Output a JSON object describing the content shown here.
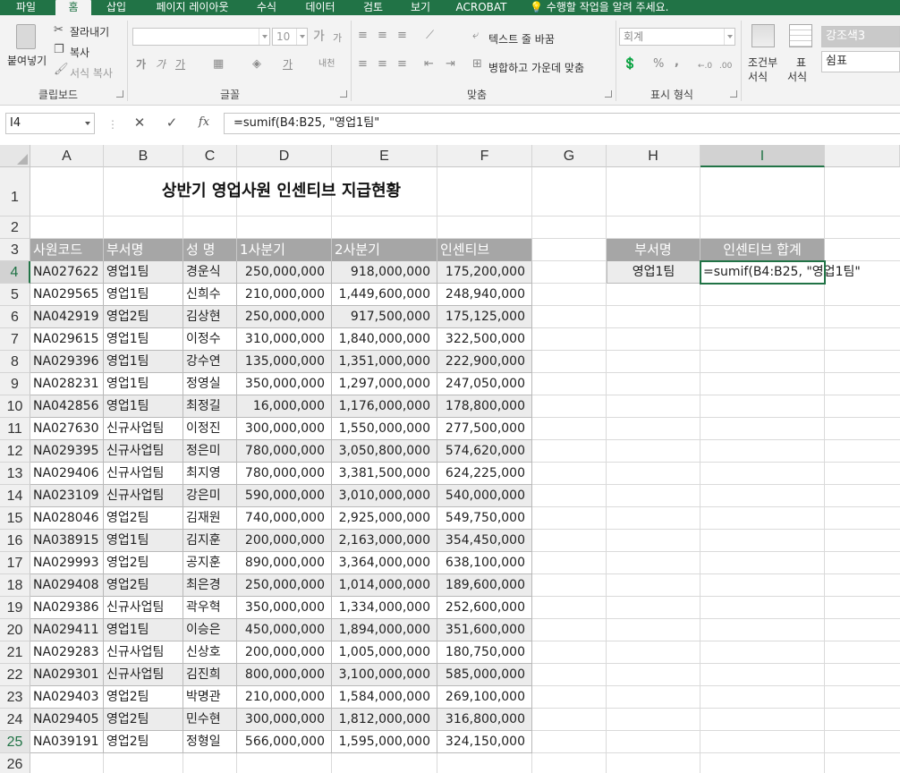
{
  "ribbon": {
    "tabs": [
      "파일",
      "홈",
      "삽입",
      "페이지 레이아웃",
      "수식",
      "데이터",
      "검토",
      "보기",
      "ACROBAT"
    ],
    "tell_me": "수행할 작업을 알려 주세요.",
    "clipboard": {
      "paste": "붙여넣기",
      "cut": "잘라내기",
      "copy": "복사",
      "format_painter": "서식 복사",
      "label": "클립보드"
    },
    "font": {
      "size": "10",
      "grow": "가",
      "shrink": "가",
      "bold": "가",
      "italic": "가",
      "underline": "가",
      "font_color": "가",
      "phonetic": "내천",
      "label": "글꼴"
    },
    "alignment": {
      "wrap": "텍스트 줄 바꿈",
      "merge": "병합하고 가운데 맞춤",
      "label": "맞춤"
    },
    "number": {
      "format": "회계",
      "percent": "%",
      "comma": ",",
      "inc": "←.0",
      "dec": ".00",
      "label": "표시 형식"
    },
    "styles": {
      "cond_1": "조건부",
      "cond_2": "서식",
      "table_1": "표",
      "table_2": "서식",
      "accent3": "강조색3",
      "comma_style": "쉼표"
    }
  },
  "formula_bar": {
    "name_box": "I4",
    "cancel": "✕",
    "enter": "✓",
    "fx": "fx",
    "formula": "=sumif(B4:B25, \"영업1팀\""
  },
  "sheet": {
    "columns": [
      "A",
      "B",
      "C",
      "D",
      "E",
      "F",
      "G",
      "H",
      "I"
    ],
    "row_numbers": [
      "1",
      "2",
      "3",
      "4",
      "5",
      "6",
      "7",
      "8",
      "9",
      "10",
      "11",
      "12",
      "13",
      "14",
      "15",
      "16",
      "17",
      "18",
      "19",
      "20",
      "21",
      "22",
      "23",
      "24",
      "25",
      "26"
    ],
    "title": "상반기 영업사원 인센티브 지급현황",
    "headers": [
      "사원코드",
      "부서명",
      "성  명",
      "1사분기",
      "2사분기",
      "인센티브"
    ],
    "rows": [
      [
        "NA027622",
        "영업1팀",
        "경운식",
        "250,000,000",
        "918,000,000",
        "175,200,000"
      ],
      [
        "NA029565",
        "영업1팀",
        "신희수",
        "210,000,000",
        "1,449,600,000",
        "248,940,000"
      ],
      [
        "NA042919",
        "영업2팀",
        "김상현",
        "250,000,000",
        "917,500,000",
        "175,125,000"
      ],
      [
        "NA029615",
        "영업1팀",
        "이정수",
        "310,000,000",
        "1,840,000,000",
        "322,500,000"
      ],
      [
        "NA029396",
        "영업1팀",
        "강수연",
        "135,000,000",
        "1,351,000,000",
        "222,900,000"
      ],
      [
        "NA028231",
        "영업1팀",
        "정영실",
        "350,000,000",
        "1,297,000,000",
        "247,050,000"
      ],
      [
        "NA042856",
        "영업1팀",
        "최정길",
        "16,000,000",
        "1,176,000,000",
        "178,800,000"
      ],
      [
        "NA027630",
        "신규사업팀",
        "이정진",
        "300,000,000",
        "1,550,000,000",
        "277,500,000"
      ],
      [
        "NA029395",
        "신규사업팀",
        "정은미",
        "780,000,000",
        "3,050,800,000",
        "574,620,000"
      ],
      [
        "NA029406",
        "신규사업팀",
        "최지영",
        "780,000,000",
        "3,381,500,000",
        "624,225,000"
      ],
      [
        "NA023109",
        "신규사업팀",
        "강은미",
        "590,000,000",
        "3,010,000,000",
        "540,000,000"
      ],
      [
        "NA028046",
        "영업2팀",
        "김재원",
        "740,000,000",
        "2,925,000,000",
        "549,750,000"
      ],
      [
        "NA038915",
        "영업1팀",
        "김지훈",
        "200,000,000",
        "2,163,000,000",
        "354,450,000"
      ],
      [
        "NA029993",
        "영업2팀",
        "공지훈",
        "890,000,000",
        "3,364,000,000",
        "638,100,000"
      ],
      [
        "NA029408",
        "영업2팀",
        "최은경",
        "250,000,000",
        "1,014,000,000",
        "189,600,000"
      ],
      [
        "NA029386",
        "신규사업팀",
        "곽우혁",
        "350,000,000",
        "1,334,000,000",
        "252,600,000"
      ],
      [
        "NA029411",
        "영업1팀",
        "이승은",
        "450,000,000",
        "1,894,000,000",
        "351,600,000"
      ],
      [
        "NA029283",
        "신규사업팀",
        "신상호",
        "200,000,000",
        "1,005,000,000",
        "180,750,000"
      ],
      [
        "NA029301",
        "신규사업팀",
        "김진희",
        "800,000,000",
        "3,100,000,000",
        "585,000,000"
      ],
      [
        "NA029403",
        "영업2팀",
        "박명관",
        "210,000,000",
        "1,584,000,000",
        "269,100,000"
      ],
      [
        "NA029405",
        "영업2팀",
        "민수현",
        "300,000,000",
        "1,812,000,000",
        "316,800,000"
      ],
      [
        "NA039191",
        "영업2팀",
        "정형일",
        "566,000,000",
        "1,595,000,000",
        "324,150,000"
      ]
    ],
    "summary": {
      "header_dept": "부서명",
      "header_total": "인센티브 합계",
      "dept": "영업1팀",
      "formula": "=sumif(B4:B25, \"영업1팀\""
    }
  }
}
